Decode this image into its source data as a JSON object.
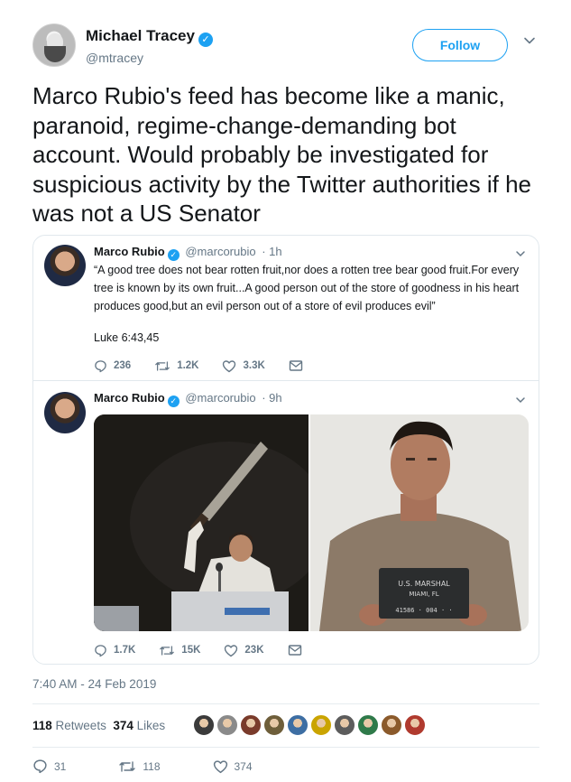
{
  "author": {
    "name": "Michael Tracey",
    "handle": "@mtracey",
    "avatar_icon": "bearded-man-avatar",
    "verified": true
  },
  "follow_button": {
    "label": "Follow"
  },
  "tweet": {
    "text": "Marco Rubio's feed has become like a manic, paranoid, regime-change-demanding bot account. Would probably be investigated for suspicious activity by the Twitter authorities if he was not a US Senator"
  },
  "quoted": [
    {
      "name": "Marco Rubio",
      "handle": "@marcorubio",
      "time": "· 1h",
      "body": "“A good tree does not bear rotten fruit,nor does a rotten tree bear good fruit.For every tree is known by its own fruit...A good person out of the store of goodness in his heart produces good,but an evil person out of a store of evil produces evil”",
      "citation": "Luke 6:43,45",
      "replies": "236",
      "retweets": "1.2K",
      "likes": "3.3K"
    },
    {
      "name": "Marco Rubio",
      "handle": "@marcorubio",
      "time": "· 9h",
      "photo_left": "man-raising-machete-at-podium",
      "photo_right": "mugshot-holding-placard",
      "placard_lines": [
        "U.S. MARSHAL",
        "MIAMI, FL",
        "41586 · 004 · ·"
      ],
      "replies": "1.7K",
      "retweets": "15K",
      "likes": "23K"
    }
  ],
  "timestamp": "7:40 AM - 24 Feb 2019",
  "stats": {
    "retweets_count": "118",
    "retweets_label": "Retweets",
    "likes_count": "374",
    "likes_label": "Likes"
  },
  "liker_avatar_colors": [
    "#3b3b3b",
    "#8a8a8a",
    "#7a3b2b",
    "#6e5e3a",
    "#3d6ea3",
    "#caa400",
    "#5c5c5c",
    "#2f7a4a",
    "#8b5a2b",
    "#b03a2e"
  ],
  "bottom_actions": {
    "replies": "31",
    "retweets": "118",
    "likes": "374"
  },
  "colors": {
    "accent": "#1da1f2",
    "secondary_text": "#657786",
    "border": "#e1e8ed"
  }
}
